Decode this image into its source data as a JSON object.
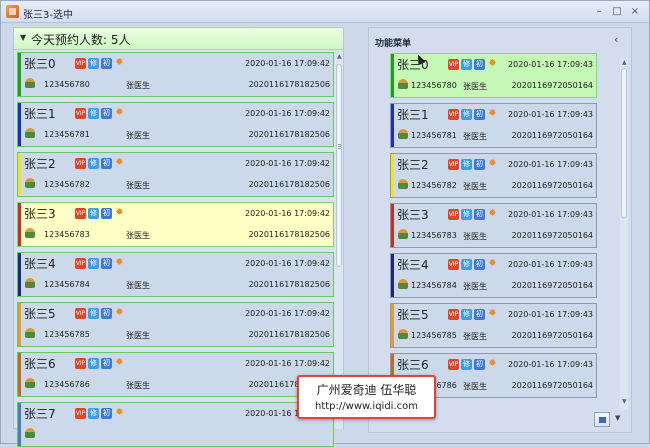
{
  "window": {
    "title": "张三3-选中",
    "controls": [
      "–",
      "□",
      "×"
    ]
  },
  "left_panel": {
    "header": "今天预约人数: 5人",
    "cards": [
      {
        "name": "张三0",
        "time": "2020-01-16 17:09:42",
        "phone": "123456780",
        "doctor": "张医生",
        "number": "20201161781825​06",
        "bar_color": "#1aa21a",
        "highlight": false
      },
      {
        "name": "张三1",
        "time": "2020-01-16 17:09:42",
        "phone": "123456781",
        "doctor": "张医生",
        "number": "2020116178182506",
        "bar_color": "#1c2fc4",
        "highlight": false
      },
      {
        "name": "张三2",
        "time": "2020-01-16 17:09:42",
        "phone": "123456782",
        "doctor": "张医生",
        "number": "2020116178182506",
        "bar_color": "#f0e51a",
        "highlight": false
      },
      {
        "name": "张三3",
        "time": "2020-01-16 17:09:42",
        "phone": "123456783",
        "doctor": "张医生",
        "number": "2020116178182506",
        "bar_color": "#d42a1a",
        "highlight": true
      },
      {
        "name": "张三4",
        "time": "2020-01-16 17:09:42",
        "phone": "123456784",
        "doctor": "张医生",
        "number": "2020116178182506",
        "bar_color": "#1b2a82",
        "highlight": false
      },
      {
        "name": "张三5",
        "time": "2020-01-16 17:09:42",
        "phone": "123456785",
        "doctor": "张医生",
        "number": "2020116178182506",
        "bar_color": "#e99a2a",
        "highlight": false
      },
      {
        "name": "张三6",
        "time": "2020-01-16 17:09:42",
        "phone": "123456786",
        "doctor": "张医生",
        "number": "2020116178182506",
        "bar_color": "#c56a1a",
        "highlight": false
      },
      {
        "name": "张三7",
        "time": "2020-01-16 17:09:42",
        "phone": "",
        "doctor": "",
        "number": "",
        "bar_color": "#4a7ac2",
        "highlight": false
      }
    ]
  },
  "right_panel": {
    "header": "功能菜单",
    "collapse": "‹",
    "cards": [
      {
        "name": "张三0",
        "time": "2020-01-16 17:09:43",
        "phone": "123456780",
        "doctor": "张医生",
        "number": "2020116972050164",
        "bar_color": "#1aa21a",
        "selected": true
      },
      {
        "name": "张三1",
        "time": "2020-01-16 17:09:43",
        "phone": "123456781",
        "doctor": "张医生",
        "number": "2020116972050164",
        "bar_color": "#1c2fc4",
        "selected": false
      },
      {
        "name": "张三2",
        "time": "2020-01-16 17:09:43",
        "phone": "123456782",
        "doctor": "张医生",
        "number": "2020116972050164",
        "bar_color": "#f0e51a",
        "selected": false
      },
      {
        "name": "张三3",
        "time": "2020-01-16 17:09:43",
        "phone": "123456783",
        "doctor": "张医生",
        "number": "2020116972050164",
        "bar_color": "#d42a1a",
        "selected": false
      },
      {
        "name": "张三4",
        "time": "2020-01-16 17:09:43",
        "phone": "123456784",
        "doctor": "张医生",
        "number": "2020116972050164",
        "bar_color": "#1b2a82",
        "selected": false
      },
      {
        "name": "张三5",
        "time": "2020-01-16 17:09:43",
        "phone": "123456785",
        "doctor": "张医生",
        "number": "2020116972050164",
        "bar_color": "#e99a2a",
        "selected": false
      },
      {
        "name": "张三6",
        "time": "2020-01-16 17:09:43",
        "phone": "123456786",
        "doctor": "张医生",
        "number": "2020116972050164",
        "bar_color": "#c56a1a",
        "selected": false
      }
    ]
  },
  "badges": {
    "vip": "VIP",
    "xiu": "修",
    "chu": "初",
    "flame": "✹"
  },
  "watermark": {
    "line1": "广州爱奇迪  伍华聪",
    "line2": "http://www.iqidi.com"
  }
}
